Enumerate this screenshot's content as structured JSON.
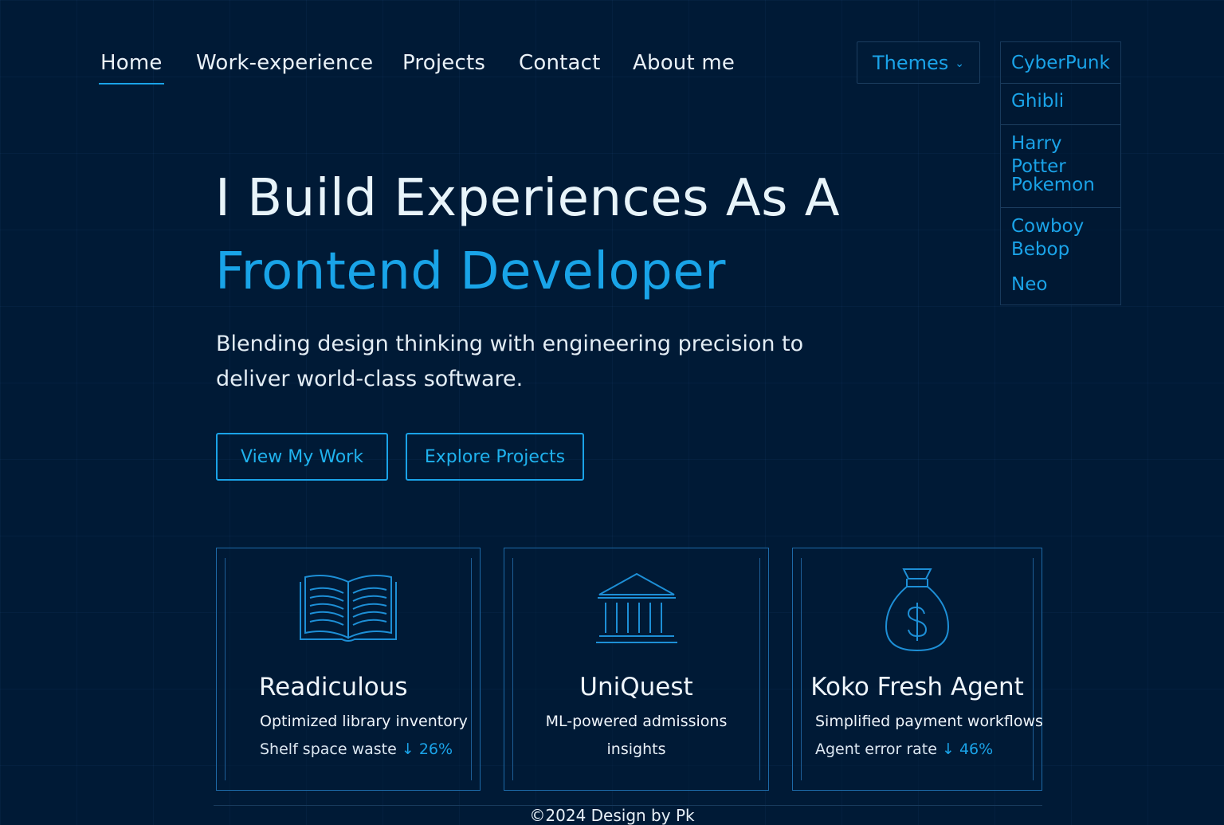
{
  "nav": {
    "items": [
      {
        "label": "Home",
        "active": true
      },
      {
        "label": "Work-experience",
        "active": false
      },
      {
        "label": "Projects",
        "active": false
      },
      {
        "label": "Contact",
        "active": false
      },
      {
        "label": "About me",
        "active": false
      }
    ]
  },
  "themes": {
    "button_label": "Themes",
    "options": [
      "CyberPunk",
      "Ghibli",
      "Harry Potter",
      "Pokemon",
      "Cowboy Bebop",
      "Neo"
    ]
  },
  "hero": {
    "title_line1": "I Build Experiences As A",
    "title_line2": "Frontend Developer",
    "subtitle": "Blending design thinking with engineering precision to deliver world-class software.",
    "primary_cta": "View My Work",
    "secondary_cta": "Explore Projects"
  },
  "projects": [
    {
      "icon": "book-icon",
      "title": "Readiculous",
      "description": "Optimized library inventory",
      "metric_label": "Shelf space waste",
      "metric_value": "26%"
    },
    {
      "icon": "bank-icon",
      "title": "UniQuest",
      "description": "ML-powered admissions",
      "metric_label": "insights",
      "metric_value": ""
    },
    {
      "icon": "money-bag-icon",
      "title": "Koko Fresh Agent",
      "description": "Simplified payment workflows",
      "metric_label": "Agent error rate",
      "metric_value": "46%"
    }
  ],
  "footer": {
    "text": "©2024 Design by Pk"
  },
  "colors": {
    "background": "#001a36",
    "accent": "#1aa3e8",
    "text": "#e8f1f8"
  }
}
